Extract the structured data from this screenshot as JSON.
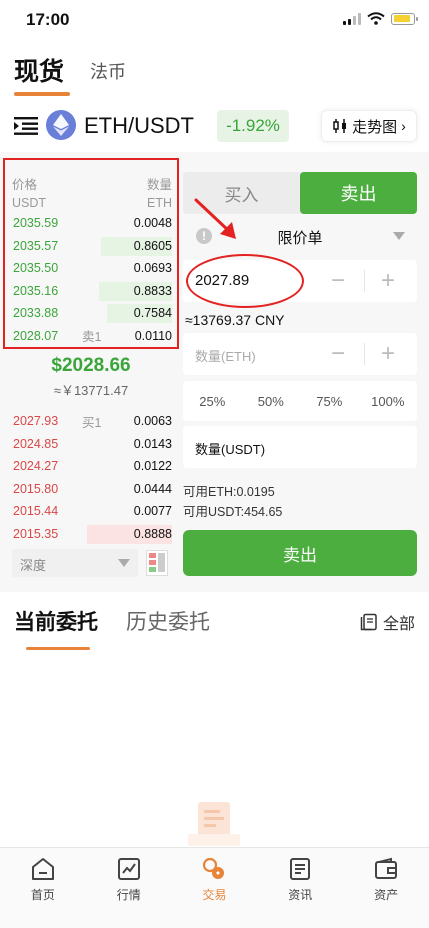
{
  "status_bar": {
    "time": "17:00"
  },
  "top_tabs": {
    "spot": "现货",
    "fiat": "法币"
  },
  "pair": {
    "name": "ETH/USDT",
    "change": "-1.92%",
    "trend_label": "走势图"
  },
  "orderbook": {
    "price_header": "价格",
    "price_unit": "USDT",
    "qty_header": "数量",
    "qty_unit": "ETH",
    "asks": [
      {
        "price": "2035.59",
        "label": "",
        "qty": "0.0048",
        "depth": 0.0
      },
      {
        "price": "2035.57",
        "label": "",
        "qty": "0.8605",
        "depth": 0.42
      },
      {
        "price": "2035.50",
        "label": "",
        "qty": "0.0693",
        "depth": 0.0
      },
      {
        "price": "2035.16",
        "label": "",
        "qty": "0.8833",
        "depth": 0.43
      },
      {
        "price": "2033.88",
        "label": "",
        "qty": "0.7584",
        "depth": 0.38
      },
      {
        "price": "2028.07",
        "label": "卖1",
        "qty": "0.0110",
        "depth": 0.0
      }
    ],
    "mid_price": "$2028.66",
    "mid_cny": "≈￥13771.47",
    "bids": [
      {
        "price": "2027.93",
        "label": "买1",
        "qty": "0.0063",
        "depth": 0.0
      },
      {
        "price": "2024.85",
        "label": "",
        "qty": "0.0143",
        "depth": 0.0
      },
      {
        "price": "2024.27",
        "label": "",
        "qty": "0.0122",
        "depth": 0.0
      },
      {
        "price": "2015.80",
        "label": "",
        "qty": "0.0444",
        "depth": 0.0
      },
      {
        "price": "2015.44",
        "label": "",
        "qty": "0.0077",
        "depth": 0.0
      },
      {
        "price": "2015.35",
        "label": "",
        "qty": "0.8888",
        "depth": 0.5
      }
    ],
    "depth_select": "深度"
  },
  "trade_form": {
    "buy_tab": "买入",
    "sell_tab": "卖出",
    "order_type": "限价单",
    "price_value": "2027.89",
    "cny_estimate": "≈13769.37 CNY",
    "amount_placeholder": "数量(ETH)",
    "percentages": [
      "25%",
      "50%",
      "75%",
      "100%"
    ],
    "total_placeholder": "数量(USDT)",
    "available_eth": "可用ETH:0.0195",
    "available_usdt": "可用USDT:454.65",
    "submit_label": "卖出"
  },
  "orders": {
    "current_tab": "当前委托",
    "history_tab": "历史委托",
    "all_label": "全部"
  },
  "bottom_nav": [
    {
      "label": "首页",
      "icon": "home-icon"
    },
    {
      "label": "行情",
      "icon": "market-chart-icon"
    },
    {
      "label": "交易",
      "icon": "trade-icon"
    },
    {
      "label": "资讯",
      "icon": "news-icon"
    },
    {
      "label": "资产",
      "icon": "wallet-icon"
    }
  ],
  "colors": {
    "accent": "#e8833a",
    "up": "#3aa53a",
    "down": "#d94747",
    "annotation": "#e32222"
  }
}
